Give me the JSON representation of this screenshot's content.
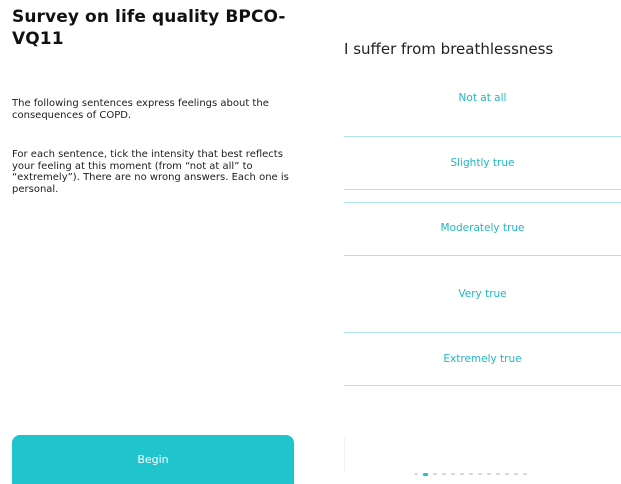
{
  "intro_screen": {
    "title": "Survey on life quality BPCO-VQ11",
    "intro_text": "The following sentences express feelings about the consequences of COPD.",
    "instructions_text": "For each sentence, tick the intensity that best reflects your feeling at this moment (from “not at all” to “extremely”). There are no wrong answers. Each one is personal.",
    "begin_label": "Begin"
  },
  "question_screen": {
    "question": "I suffer from breathlessness",
    "options": [
      {
        "label": "Not at all"
      },
      {
        "label": "Slightly true"
      },
      {
        "label": "Moderately true"
      },
      {
        "label": "Very true"
      },
      {
        "label": "Extremely true"
      }
    ],
    "pagination": {
      "total_pages": 13,
      "current_page": 2
    }
  },
  "colors": {
    "accent": "#1fc4cc",
    "option_text": "#1fb7c2",
    "divider": "#aee3e8"
  }
}
